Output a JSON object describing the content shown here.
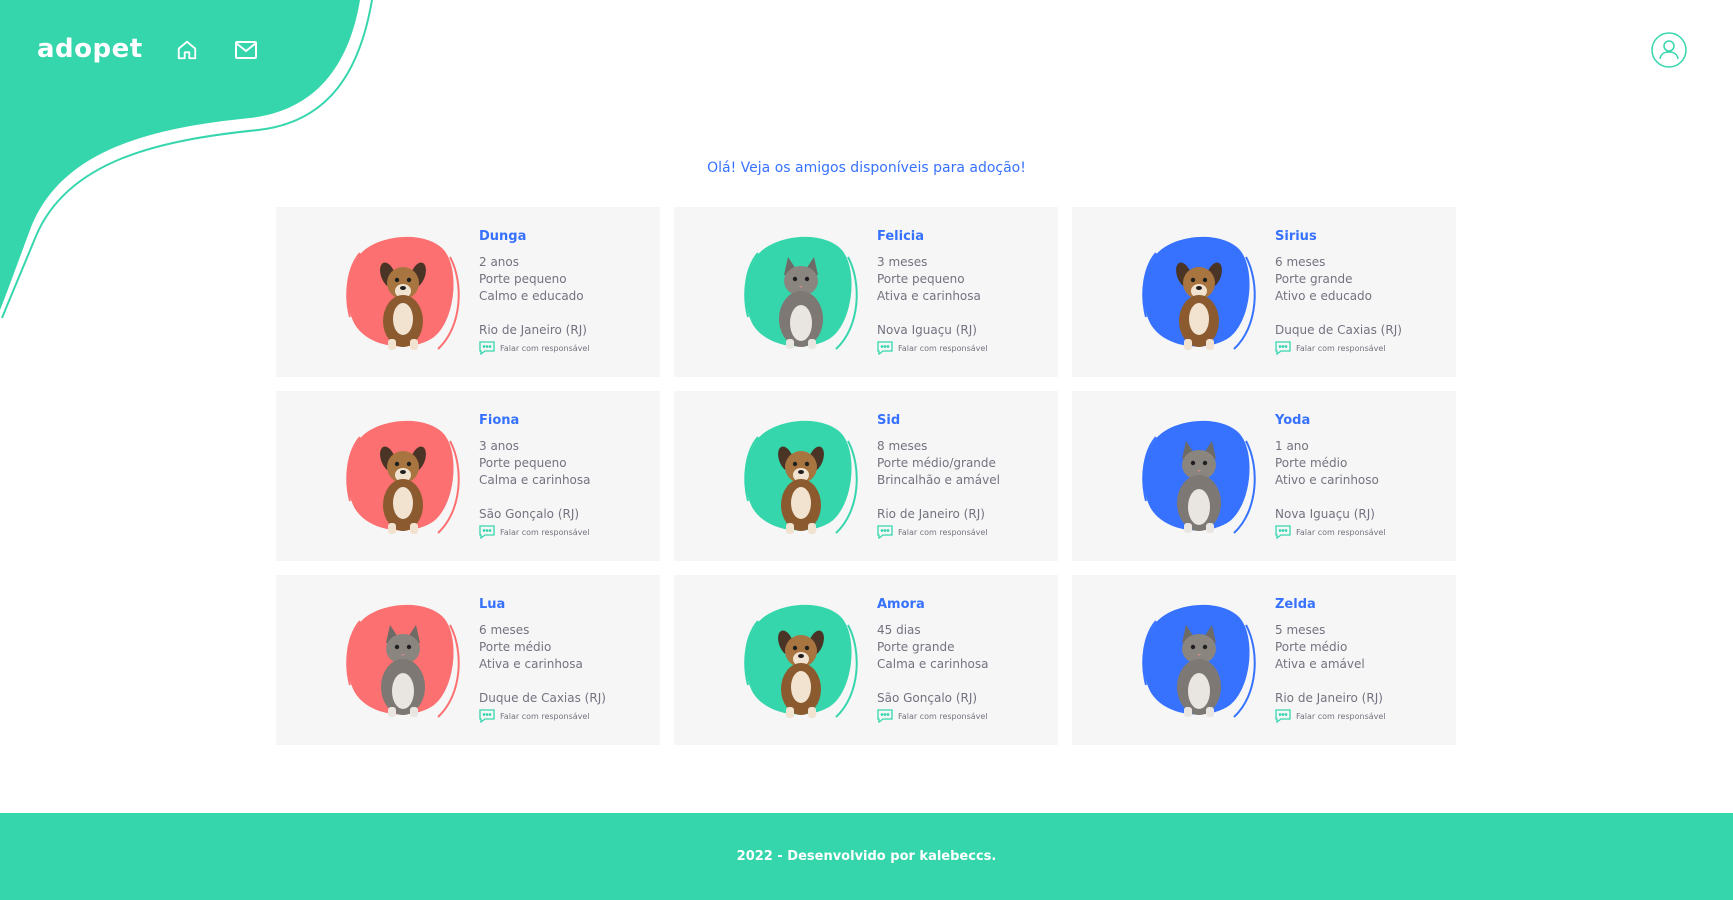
{
  "header": {
    "logo": "adopet",
    "nav": [
      {
        "icon": "home-icon"
      },
      {
        "icon": "mail-icon"
      }
    ],
    "user_icon": "user-icon"
  },
  "colors": {
    "brand_teal": "#36D6AD",
    "blue": "#3772FF",
    "red": "#FC7071",
    "card_bg": "#F6F6F6",
    "text_gray": "#737380"
  },
  "greeting": "Olá! Veja os amigos disponíveis para adoção!",
  "pets": [
    {
      "name": "Dunga",
      "age": "2 anos",
      "size": "Porte pequeno",
      "temper": "Calmo e educado",
      "city": "Rio de Janeiro (RJ)",
      "contact": "Falar com responsável",
      "blob": "red",
      "animal": "dog"
    },
    {
      "name": "Felicia",
      "age": "3 meses",
      "size": "Porte pequeno",
      "temper": "Ativa e carinhosa",
      "city": "Nova Iguaçu (RJ)",
      "contact": "Falar com responsável",
      "blob": "teal",
      "animal": "cat"
    },
    {
      "name": "Sirius",
      "age": "6 meses",
      "size": "Porte grande",
      "temper": "Ativo e educado",
      "city": "Duque de Caxias (RJ)",
      "contact": "Falar com responsável",
      "blob": "blue",
      "animal": "dog"
    },
    {
      "name": "Fiona",
      "age": "3 anos",
      "size": "Porte pequeno",
      "temper": "Calma e carinhosa",
      "city": "São Gonçalo (RJ)",
      "contact": "Falar com responsável",
      "blob": "red",
      "animal": "dog"
    },
    {
      "name": "Sid",
      "age": "8 meses",
      "size": "Porte médio/grande",
      "temper": "Brincalhão e amável",
      "city": "Rio de Janeiro (RJ)",
      "contact": "Falar com responsável",
      "blob": "teal",
      "animal": "dog"
    },
    {
      "name": "Yoda",
      "age": "1 ano",
      "size": "Porte médio",
      "temper": "Ativo e carinhoso",
      "city": "Nova Iguaçu (RJ)",
      "contact": "Falar com responsável",
      "blob": "blue",
      "animal": "cat"
    },
    {
      "name": "Lua",
      "age": "6 meses",
      "size": "Porte médio",
      "temper": "Ativa e carinhosa",
      "city": "Duque de Caxias (RJ)",
      "contact": "Falar com responsável",
      "blob": "red",
      "animal": "cat"
    },
    {
      "name": "Amora",
      "age": "45 dias",
      "size": "Porte grande",
      "temper": "Calma e carinhosa",
      "city": "São Gonçalo (RJ)",
      "contact": "Falar com responsável",
      "blob": "teal",
      "animal": "dog"
    },
    {
      "name": "Zelda",
      "age": "5 meses",
      "size": "Porte médio",
      "temper": "Ativa e amável",
      "city": "Rio de Janeiro (RJ)",
      "contact": "Falar com responsável",
      "blob": "blue",
      "animal": "cat"
    }
  ],
  "footer": {
    "text": "2022 - Desenvolvido por kalebeccs."
  }
}
